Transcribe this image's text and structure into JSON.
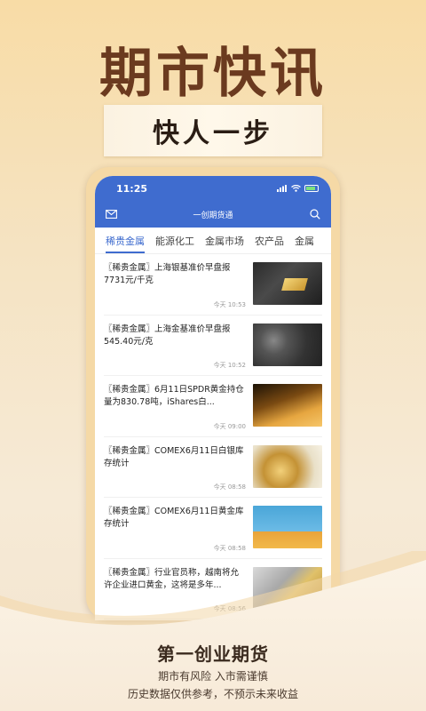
{
  "hero": {
    "title": "期市快讯",
    "slogan": "快人一步"
  },
  "status_bar": {
    "time": "11:25"
  },
  "nav": {
    "title": "一创期货通"
  },
  "tabs": [
    {
      "label": "稀贵金属",
      "active": true
    },
    {
      "label": "能源化工",
      "active": false
    },
    {
      "label": "金属市场",
      "active": false
    },
    {
      "label": "农产品",
      "active": false
    },
    {
      "label": "金属",
      "active": false
    }
  ],
  "news": [
    {
      "title": "〖稀贵金属〗上海银基准价早盘报7731元/千克",
      "time": "今天 10:53"
    },
    {
      "title": "〖稀贵金属〗上海金基准价早盘报545.40元/克",
      "time": "今天 10:52"
    },
    {
      "title": "〖稀贵金属〗6月11日SPDR黄金持仓量为830.78吨，iShares白...",
      "time": "今天 09:00"
    },
    {
      "title": "〖稀贵金属〗COMEX6月11日白银库存统计",
      "time": "今天 08:58"
    },
    {
      "title": "〖稀贵金属〗COMEX6月11日黄金库存统计",
      "time": "今天 08:58"
    },
    {
      "title": "〖稀贵金属〗行业官员称，越南将允许企业进口黄金，这将是多年...",
      "time": "今天 08:56"
    }
  ],
  "footer": {
    "brand": "第一创业期货",
    "line1": "期市有风险 入市需谨慎",
    "line2": "历史数据仅供参考，不预示未来收益"
  },
  "colors": {
    "accent": "#3f6ccf",
    "hero_title": "#6b3a1f"
  }
}
